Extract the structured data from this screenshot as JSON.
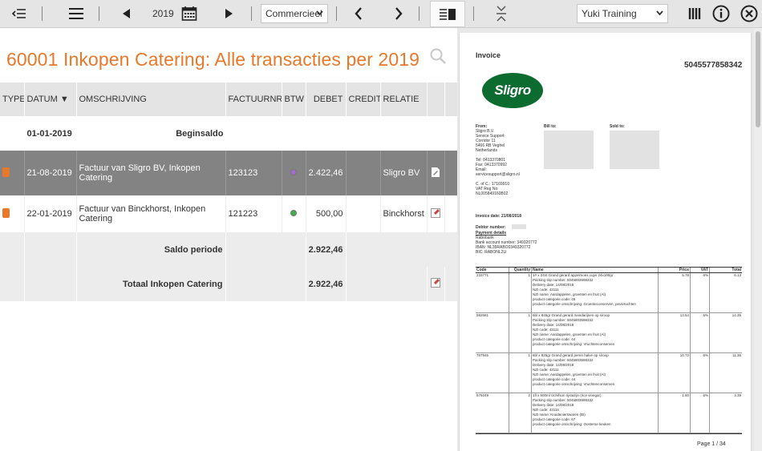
{
  "toolbar": {
    "year": "2019",
    "ledger_select": "Commercieel",
    "company_select": "Yuki Training"
  },
  "page": {
    "title": "60001 Inkopen Catering: Alle transacties per 2019"
  },
  "table": {
    "columns": [
      "TYPE",
      "DATUM ▼",
      "OMSCHRIJVING",
      "FACTUURNR.",
      "BTW",
      "DEBET",
      "CREDIT",
      "RELATIE"
    ],
    "opening": {
      "date": "01-01-2019",
      "label": "Beginsaldo"
    },
    "rows": [
      {
        "date": "21-08-2019",
        "description": "Factuur van Sligro BV, Inkopen Catering",
        "invoice": "123123",
        "btw_color": "#a36bd1",
        "debet": "2.422,46",
        "credit": "",
        "relation": "Sligro BV"
      },
      {
        "date": "22-01-2019",
        "description": "Factuur van Binckhorst, Inkopen Catering",
        "invoice": "121223",
        "btw_color": "#3bb04a",
        "debet": "500,00",
        "credit": "",
        "relation": "Binckhorst"
      }
    ],
    "saldo_periode": {
      "label": "Saldo periode",
      "debet": "2.922,46"
    },
    "totaal": {
      "label": "Totaal Inkopen Catering",
      "debet": "2.922,46"
    }
  },
  "document": {
    "title": "Invoice",
    "number": "5045577858342",
    "logo_text": "Sligro",
    "from_label": "From:",
    "from_lines": [
      "Sligro B.V.",
      "Service Support",
      "Corridor 11",
      "5466 RB Veghel",
      "Netherlands",
      "",
      "Tel: 0413370801",
      "Fax: 0413370992",
      "Email:",
      "servicesupport@sligro.nl",
      "",
      "C. of C.: 17169910",
      "VAT Reg No:",
      "NL005849160B02"
    ],
    "bill_to_label": "Bill to:",
    "sold_to_label": "Sold to:",
    "invoice_date": "Invoice date: 21/08/2018",
    "debtor_label": "Debtor number:",
    "payment_label": "Payment details",
    "payment_lines": [
      "Rabobank",
      "Bank account number: 349320772",
      "IBAN: NL35RABO0349320772",
      "BIC: RABONL2U"
    ],
    "table_headers": [
      "Code",
      "Quantity",
      "Name",
      "Price",
      "VAT",
      "Total"
    ],
    "items": [
      {
        "code": "233771",
        "qty": "1",
        "lines": [
          "1# x 24st Grand gerard appelmoes cups 24x100gr",
          "Packing slip number: 5045803598332",
          "Delivery date: 14/08/2018",
          "NZI code: 43111",
          "NZI name: Aardappelen, groenten en fruit (Al)",
          "product categorie code: 45",
          "product categorie omschrijving: Groenteconserven, peulvruchten"
        ],
        "price": "5.78",
        "vat": "6%",
        "total": "6.13"
      },
      {
        "code": "592581",
        "qty": "1",
        "lines": [
          "6bl x 845gr Grand gerard mandarijnen op siroop",
          "Packing slip number: 5045803598332",
          "Delivery date: 14/08/2018",
          "NZI code: 43111",
          "NZI name: Aardappelen, groenten en fruit (Al)",
          "product categorie code: 44",
          "product categorie omschrijving: Vruchtenconserven"
        ],
        "price": "13.54",
        "vat": "6%",
        "total": "14.35"
      },
      {
        "code": "767945",
        "qty": "1",
        "lines": [
          "6bl x 825gr Grand gerard peren halve op siroop",
          "Packing slip number: 5045803598332",
          "Delivery date: 14/08/2018",
          "NZI code: 43111",
          "NZI name: Aardappelen, groenten en fruit (Al)",
          "product categorie code: 44",
          "product categorie omschrijving: Vruchtenconserven"
        ],
        "price": "10.72",
        "vat": "6%",
        "total": "11.36"
      },
      {
        "code": "679249",
        "qty": "2",
        "lines": [
          "1fl x 500ml Uchifson rijstazijn (rice vinegar)",
          "Packing slip number: 5045803598332",
          "Delivery date: 14/08/2018",
          "NZI code: 43115",
          "NZI name: Kruidenierswaren (BI)",
          "product categorie code: 67",
          "product categorie omschrijving: Oosterse keuken"
        ],
        "price": "1.60",
        "vat": "6%",
        "total": "3.39"
      }
    ],
    "page_indicator": "Page 1 / 34"
  }
}
